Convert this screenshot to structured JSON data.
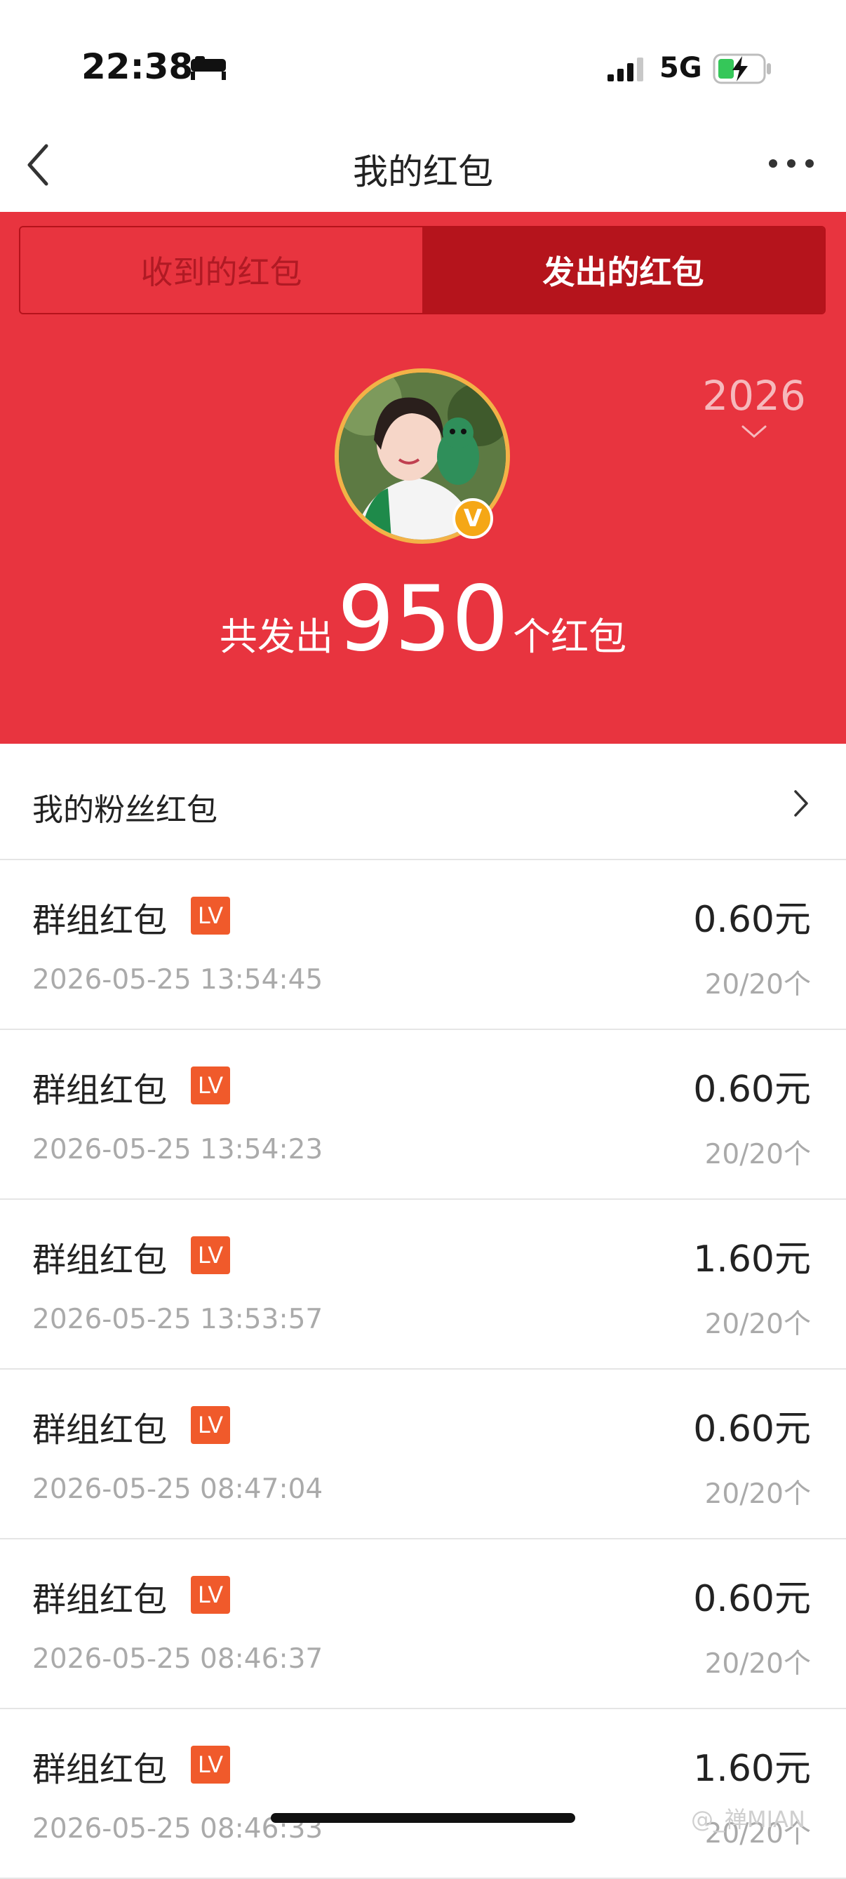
{
  "status_bar": {
    "time": "22:38",
    "network": "5G",
    "icons": [
      "bed-icon",
      "signal-icon",
      "battery-charging-icon"
    ]
  },
  "nav": {
    "title": "我的红包",
    "icons": [
      "back-icon",
      "more-icon"
    ]
  },
  "tabs": [
    {
      "label": "收到的红包",
      "active": false
    },
    {
      "label": "发出的红包",
      "active": true
    }
  ],
  "header": {
    "year": "2026",
    "summary_prefix": "共发出",
    "summary_count": "950",
    "summary_suffix": "个红包",
    "badge": "V",
    "colors": {
      "background": "#e8343f",
      "active_tab": "#b5141c",
      "avatar_ring": "#f3b247",
      "badge": "#f5a716"
    }
  },
  "fan_section": {
    "label": "我的粉丝红包"
  },
  "records": [
    {
      "title": "群组红包",
      "badge": "LV",
      "time": "2026-05-25 13:54:45",
      "amount": "0.60元",
      "count": "20/20个"
    },
    {
      "title": "群组红包",
      "badge": "LV",
      "time": "2026-05-25 13:54:23",
      "amount": "0.60元",
      "count": "20/20个"
    },
    {
      "title": "群组红包",
      "badge": "LV",
      "time": "2026-05-25 13:53:57",
      "amount": "1.60元",
      "count": "20/20个"
    },
    {
      "title": "群组红包",
      "badge": "LV",
      "time": "2026-05-25 08:47:04",
      "amount": "0.60元",
      "count": "20/20个"
    },
    {
      "title": "群组红包",
      "badge": "LV",
      "time": "2026-05-25 08:46:37",
      "amount": "0.60元",
      "count": "20/20个"
    },
    {
      "title": "群组红包",
      "badge": "LV",
      "time": "2026-05-25 08:46:33",
      "amount": "1.60元",
      "count": "20/20个"
    }
  ],
  "watermark": "@_禅MIAN"
}
